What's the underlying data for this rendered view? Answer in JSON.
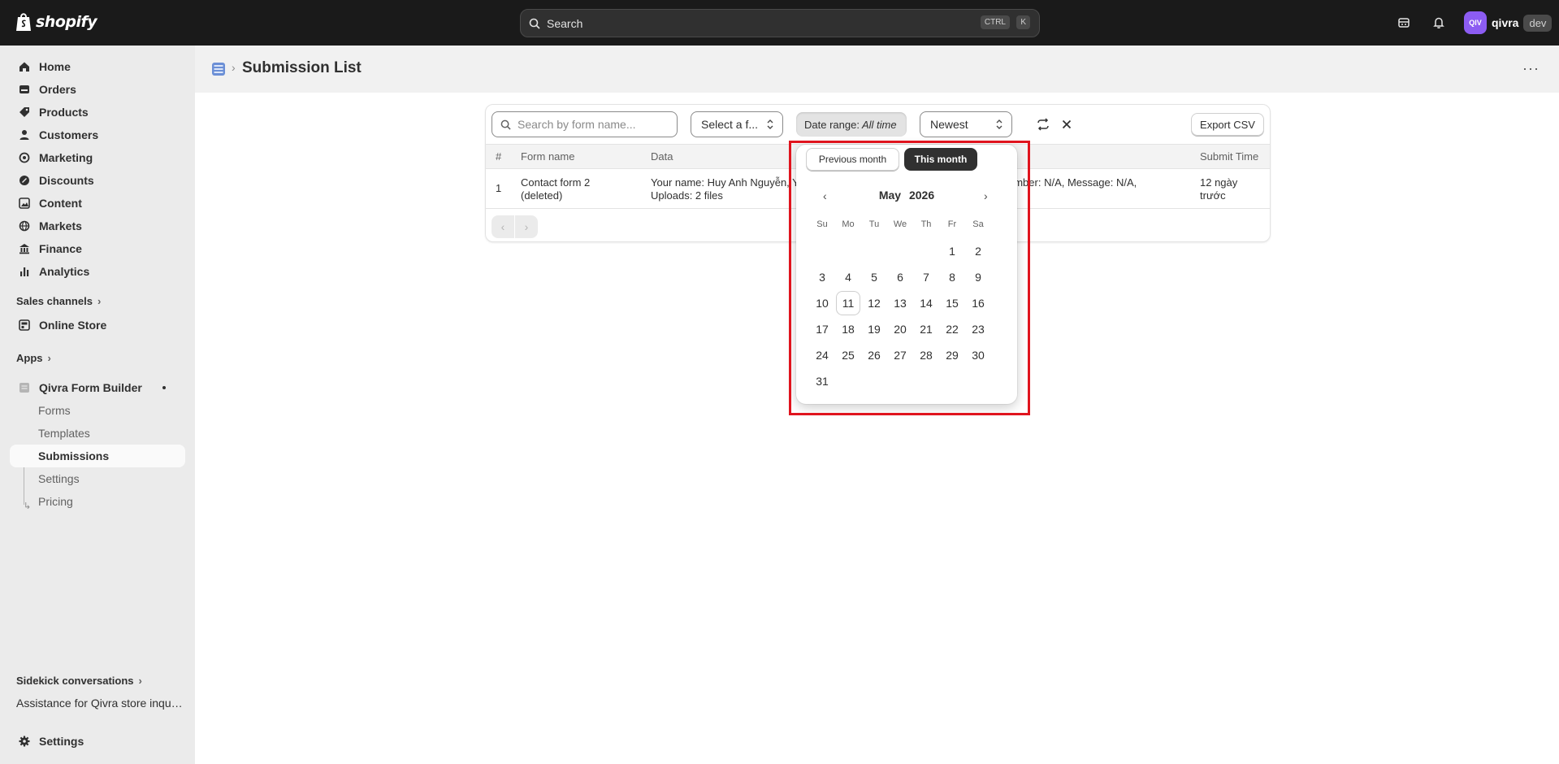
{
  "topbar": {
    "logo_text": "shopify",
    "search_placeholder": "Search",
    "shortcut_ctrl": "CTRL",
    "shortcut_k": "K",
    "icons": [
      "store-icon",
      "bell-icon"
    ],
    "user_initials": "QIV",
    "user_name": "qivra",
    "env_badge": "dev",
    "avatar_color": "#8c5cf2"
  },
  "sidebar": {
    "items": [
      {
        "label": "Home",
        "icon": "home-icon"
      },
      {
        "label": "Orders",
        "icon": "orders-icon"
      },
      {
        "label": "Products",
        "icon": "tag-icon"
      },
      {
        "label": "Customers",
        "icon": "person-icon"
      },
      {
        "label": "Marketing",
        "icon": "target-icon"
      },
      {
        "label": "Discounts",
        "icon": "discount-icon"
      },
      {
        "label": "Content",
        "icon": "content-icon"
      },
      {
        "label": "Markets",
        "icon": "globe-icon"
      },
      {
        "label": "Finance",
        "icon": "bank-icon"
      },
      {
        "label": "Analytics",
        "icon": "chart-bar-icon"
      }
    ],
    "sales_channels_label": "Sales channels",
    "online_store_label": "Online Store",
    "apps_label": "Apps",
    "app_name": "Qivra Form Builder",
    "app_sub_items": [
      "Forms",
      "Templates",
      "Submissions",
      "Settings",
      "Pricing"
    ],
    "active_sub_item": "Submissions",
    "sidekick_label": "Sidekick conversations",
    "sidekick_item": "Assistance for Qivra store inquiries",
    "settings_label": "Settings"
  },
  "header": {
    "title": "Submission List"
  },
  "filters": {
    "search_placeholder": "Search by form name...",
    "form_select": "Select a f...",
    "date_range_label": "Date range:",
    "date_range_value": "All time",
    "sort_select": "Newest",
    "export_label": "Export CSV"
  },
  "table": {
    "columns": [
      "#",
      "Form name",
      "Data",
      "Submit Time"
    ],
    "rows": [
      {
        "index": "1",
        "form_name_line1": "Contact form 2",
        "form_name_line2": "(deleted)",
        "data_line1_left": "Your name: Huy Anh Nguyễn, Y",
        "data_line1_right": "umber: N/A, Message: N/A,",
        "data_line2": "Uploads: 2 files",
        "submit_time_line1": "12 ngày",
        "submit_time_line2": "trước"
      }
    ]
  },
  "datepicker": {
    "previous_month_label": "Previous month",
    "this_month_label": "This month",
    "month": "May",
    "year": "2026",
    "weekdays": [
      "Su",
      "Mo",
      "Tu",
      "We",
      "Th",
      "Fr",
      "Sa"
    ],
    "first_weekday_index": 5,
    "days_in_month": 31,
    "today": 11
  },
  "colors": {
    "topbar_bg": "#1a1a1a",
    "highlight_border": "#e0141e",
    "primary_button": "#303030"
  }
}
